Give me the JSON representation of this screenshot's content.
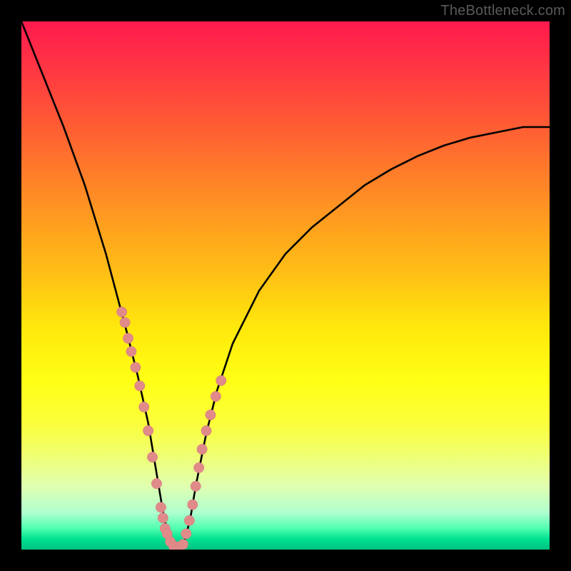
{
  "watermark": "TheBottleneck.com",
  "chart_data": {
    "type": "line",
    "title": "",
    "xlabel": "",
    "ylabel": "",
    "xlim": [
      0,
      100
    ],
    "ylim": [
      0,
      100
    ],
    "x": [
      0,
      4,
      8,
      12,
      16,
      20,
      22,
      24,
      25,
      26,
      27,
      28,
      29,
      30,
      31,
      32,
      33,
      35,
      37,
      40,
      45,
      50,
      55,
      60,
      65,
      70,
      75,
      80,
      85,
      90,
      95,
      100
    ],
    "y": [
      100,
      90,
      80,
      69,
      56,
      41,
      33,
      24,
      18,
      12,
      6,
      2,
      0.5,
      0.5,
      2,
      6,
      12,
      22,
      30,
      39,
      49,
      56,
      61,
      65,
      69,
      72,
      74.5,
      76.5,
      78,
      79,
      80,
      80
    ],
    "markers": {
      "left_branch_x": [
        19.0,
        19.6,
        20.2,
        20.8,
        21.6,
        22.4,
        23.2,
        24.0,
        24.8,
        25.6,
        26.4,
        27.2,
        26.8,
        27.6,
        28.2,
        28.8,
        29.4,
        30.0,
        30.6
      ],
      "left_branch_y": [
        45,
        43,
        40,
        37.5,
        34.5,
        31,
        27,
        22.5,
        17.5,
        12.5,
        8.0,
        4.0,
        6.0,
        3.0,
        1.5,
        0.7,
        0.5,
        0.5,
        1.0
      ],
      "right_branch_x": [
        31.2,
        31.8,
        32.4,
        33.0,
        33.6,
        34.2,
        35.0,
        35.8,
        36.8,
        37.8
      ],
      "right_branch_y": [
        3.0,
        5.5,
        8.5,
        12.0,
        15.5,
        19.0,
        22.5,
        25.5,
        29.0,
        32.0
      ]
    },
    "gradient_stops": [
      {
        "pos": 0,
        "color": "#ff1a4d"
      },
      {
        "pos": 50,
        "color": "#ffd000"
      },
      {
        "pos": 100,
        "color": "#00c080"
      }
    ]
  }
}
